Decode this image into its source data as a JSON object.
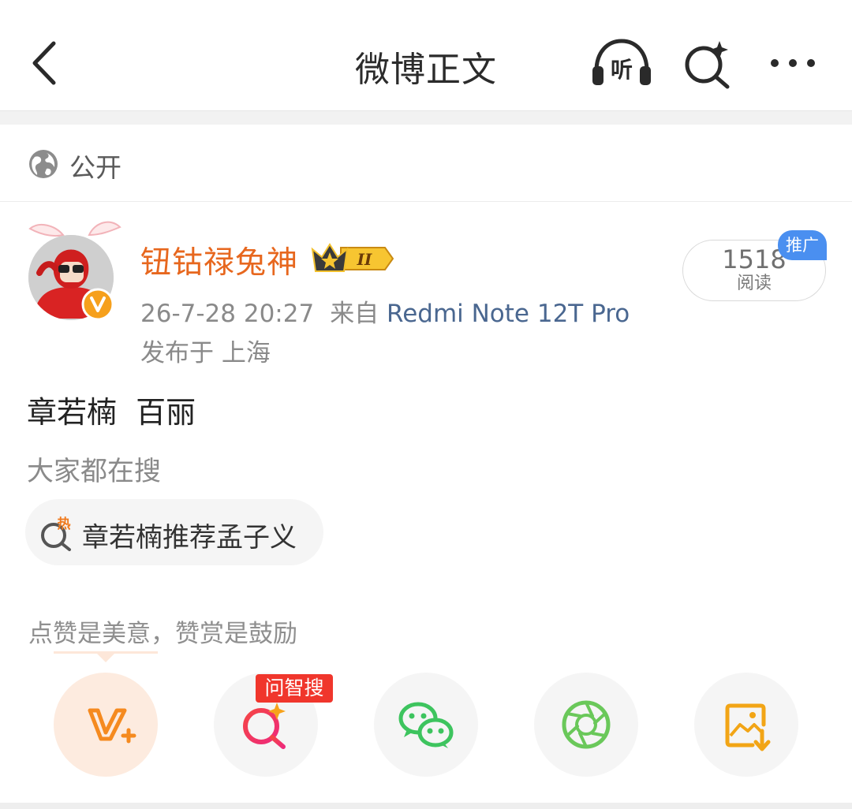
{
  "header": {
    "title": "微博正文",
    "listen_icon_text": "听",
    "icons": [
      "back-arrow-icon",
      "headphones-listen-icon",
      "sparkle-search-icon",
      "more-dots-icon"
    ]
  },
  "visibility": {
    "label": "公开",
    "icon": "globe-icon"
  },
  "author": {
    "name": "钮钴禄兔神",
    "name_color": "#e7671e",
    "badge_level": "II",
    "verified": true
  },
  "reads": {
    "count": "1518",
    "label": "阅读",
    "promo_tag": "推广"
  },
  "post": {
    "time": "26-7-28 20:27",
    "source_prefix": "来自",
    "device": "Redmi Note 12T Pro",
    "location": "发布于 上海",
    "text": "章若楠  百丽"
  },
  "search": {
    "heading": "大家都在搜",
    "hot_badge": "热",
    "hot_query": "章若楠推荐孟子义"
  },
  "reward": {
    "hint": "点赞是美意，赞赏是鼓励"
  },
  "actions": {
    "wenzhi_tag": "问智搜",
    "items": [
      "reward-v-plus-icon",
      "wenzhi-search-icon",
      "wechat-icon",
      "moments-icon",
      "save-image-icon"
    ]
  },
  "colors": {
    "accent_orange": "#e7671e",
    "link_blue": "#4a6790",
    "promo_blue": "#4a8ff0",
    "tag_red": "#f0362c",
    "wechat_green": "#3dc45e"
  }
}
